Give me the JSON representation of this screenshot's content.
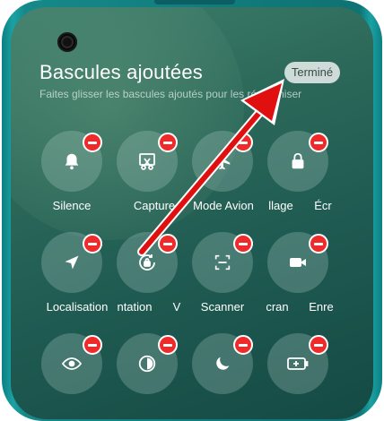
{
  "header": {
    "title": "Bascules ajoutées",
    "done_label": "Terminé",
    "subtitle": "Faites glisser les bascules ajoutés pour les réorganiser"
  },
  "tiles": [
    {
      "label": "Silence",
      "icon": "bell-icon"
    },
    {
      "label": "Capture",
      "icon": "scissors-icon"
    },
    {
      "label": "Mode Avion",
      "icon": "airplane-icon"
    },
    {
      "label": "llage",
      "icon": "lock-icon"
    },
    {
      "label": "Écr",
      "icon": "screen-icon"
    },
    {
      "label": "Localisation",
      "icon": "location-icon"
    },
    {
      "label": "ntation",
      "icon": "rotation-lock-icon"
    },
    {
      "label": "V",
      "icon": "unknown-icon"
    },
    {
      "label": "Scanner",
      "icon": "scanner-icon"
    },
    {
      "label": "cran",
      "icon": "screen-record-icon"
    },
    {
      "label": "Enre",
      "icon": "video-camera-icon"
    },
    {
      "label": "",
      "icon": "eye-icon"
    },
    {
      "label": "",
      "icon": "contrast-icon"
    },
    {
      "label": "",
      "icon": "moon-icon"
    },
    {
      "label": "",
      "icon": "battery-icon"
    }
  ],
  "colors": {
    "remove_badge": "#ee2a2a",
    "annotation_arrow": "#e01010"
  }
}
